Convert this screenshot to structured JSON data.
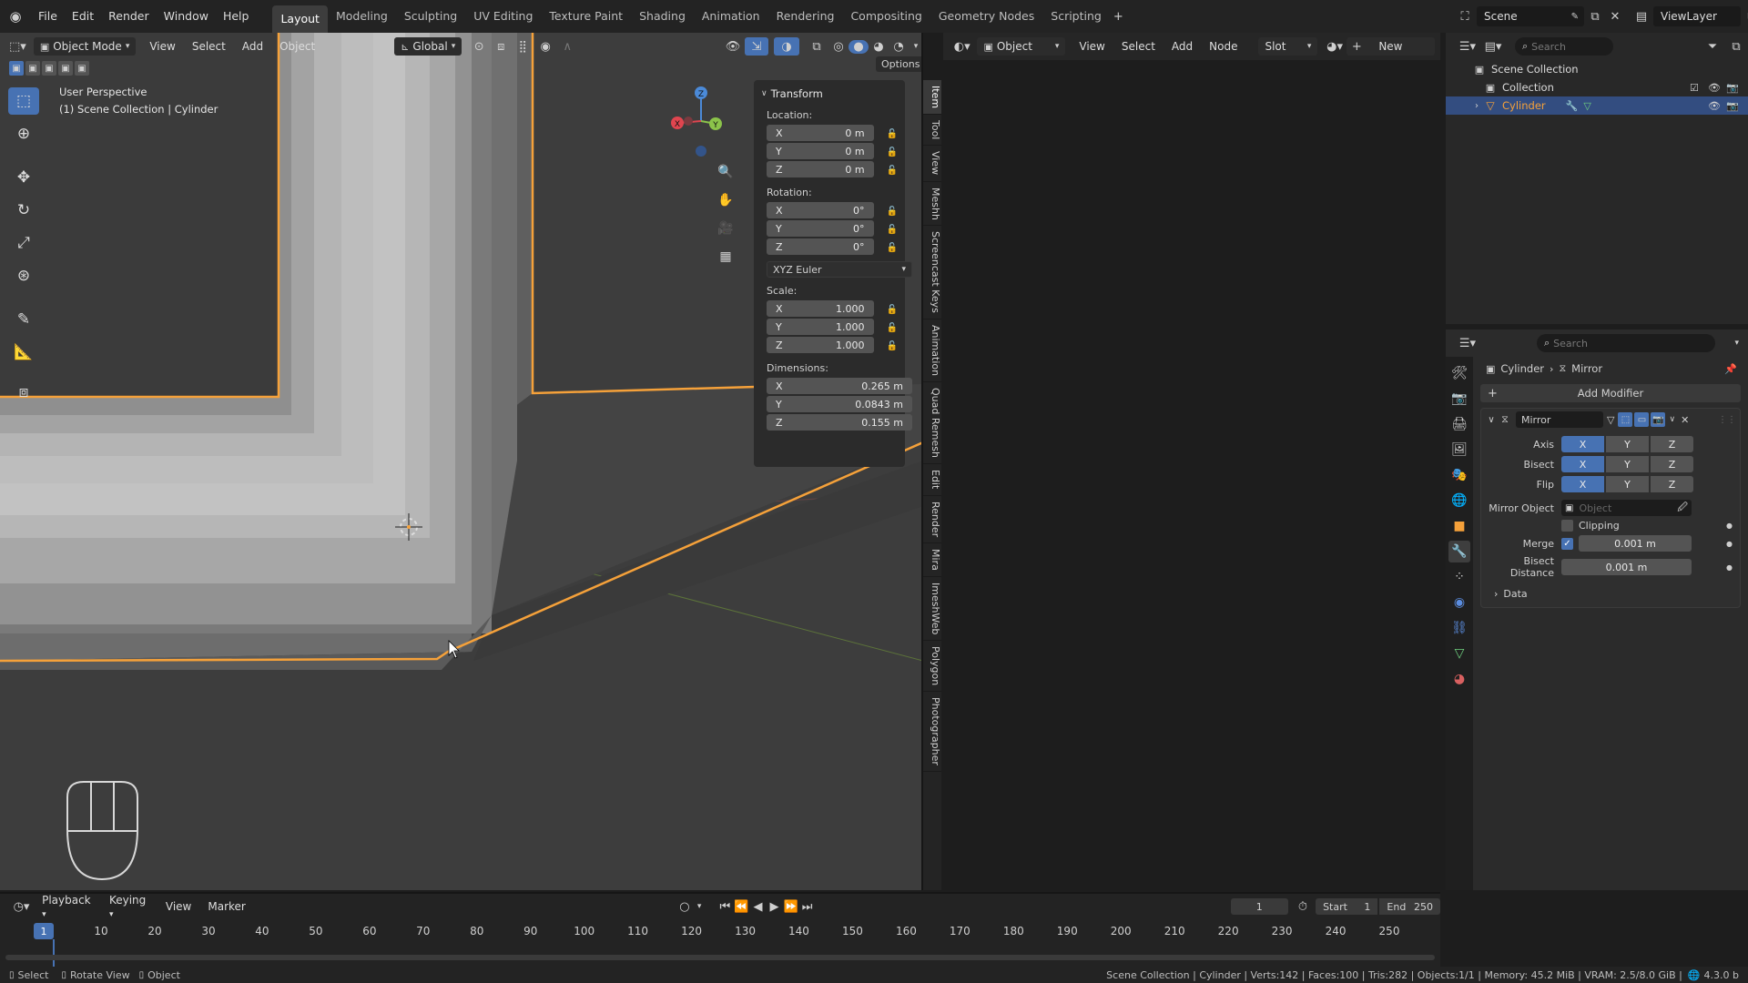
{
  "topbar": {
    "menus": [
      "File",
      "Edit",
      "Render",
      "Window",
      "Help"
    ],
    "workspaces": [
      "Layout",
      "Modeling",
      "Sculpting",
      "UV Editing",
      "Texture Paint",
      "Shading",
      "Animation",
      "Rendering",
      "Compositing",
      "Geometry Nodes",
      "Scripting"
    ],
    "active_workspace": "Layout",
    "scene": "Scene",
    "view_layer": "ViewLayer"
  },
  "viewport": {
    "mode": "Object Mode",
    "menus": [
      "View",
      "Select",
      "Add",
      "Object"
    ],
    "orientation": "Global",
    "options": "Options",
    "overlay_line1": "User Perspective",
    "overlay_line2": "(1) Scene Collection | Cylinder",
    "gizmo": {
      "x": "X",
      "y": "Y",
      "z": "Z"
    }
  },
  "n_panel": {
    "title": "Transform",
    "location_label": "Location:",
    "location": [
      {
        "axis": "X",
        "value": "0 m"
      },
      {
        "axis": "Y",
        "value": "0 m"
      },
      {
        "axis": "Z",
        "value": "0 m"
      }
    ],
    "rotation_label": "Rotation:",
    "rotation": [
      {
        "axis": "X",
        "value": "0°"
      },
      {
        "axis": "Y",
        "value": "0°"
      },
      {
        "axis": "Z",
        "value": "0°"
      }
    ],
    "rotation_mode": "XYZ Euler",
    "scale_label": "Scale:",
    "scale": [
      {
        "axis": "X",
        "value": "1.000"
      },
      {
        "axis": "Y",
        "value": "1.000"
      },
      {
        "axis": "Z",
        "value": "1.000"
      }
    ],
    "dimensions_label": "Dimensions:",
    "dimensions": [
      {
        "axis": "X",
        "value": "0.265 m"
      },
      {
        "axis": "Y",
        "value": "0.0843 m"
      },
      {
        "axis": "Z",
        "value": "0.155 m"
      }
    ]
  },
  "side_tabs": [
    "Item",
    "Tool",
    "View",
    "Meshh",
    "Screencast Keys",
    "Animation",
    "Quad Remesh",
    "Edit",
    "Render",
    "Mira",
    "ImeshWeb",
    "Polygon",
    "Photographer"
  ],
  "node_editor": {
    "object": "Object",
    "menus": [
      "View",
      "Select",
      "Add",
      "Node"
    ],
    "slot": "Slot",
    "new_label": "New"
  },
  "outliner": {
    "search_placeholder": "Search",
    "scene_collection": "Scene Collection",
    "collection": "Collection",
    "object": "Cylinder"
  },
  "properties": {
    "search_placeholder": "Search",
    "breadcrumb_object": "Cylinder",
    "breadcrumb_modifier": "Mirror",
    "add_modifier": "Add Modifier",
    "modifier_name": "Mirror",
    "axis_label": "Axis",
    "bisect_label": "Bisect",
    "flip_label": "Flip",
    "axes": [
      "X",
      "Y",
      "Z"
    ],
    "mirror_object_label": "Mirror Object",
    "mirror_object_placeholder": "Object",
    "clipping_label": "Clipping",
    "merge_label": "Merge",
    "merge_value": "0.001 m",
    "bisect_distance_label": "Bisect Distance",
    "bisect_distance_value": "0.001 m",
    "data_label": "Data"
  },
  "timeline": {
    "menus": [
      "Playback",
      "Keying",
      "View",
      "Marker"
    ],
    "current_frame": "1",
    "start_label": "Start",
    "start": "1",
    "end_label": "End",
    "end": "250",
    "ticks": [
      "1",
      "10",
      "20",
      "30",
      "40",
      "50",
      "60",
      "70",
      "80",
      "90",
      "100",
      "110",
      "120",
      "130",
      "140",
      "150",
      "160",
      "170",
      "180",
      "190",
      "200",
      "210",
      "220",
      "230",
      "240",
      "250"
    ]
  },
  "statusbar": {
    "select": "Select",
    "rotate": "Rotate View",
    "object": "Object",
    "stats": "Scene Collection | Cylinder | Verts:142 | Faces:100 | Tris:282 | Objects:1/1 | Memory: 45.2 MiB | VRAM: 2.5/8.0 GiB |",
    "version": "4.3.0 b"
  },
  "colors": {
    "accent": "#4772b3",
    "selection_outline": "#f5a13a"
  }
}
